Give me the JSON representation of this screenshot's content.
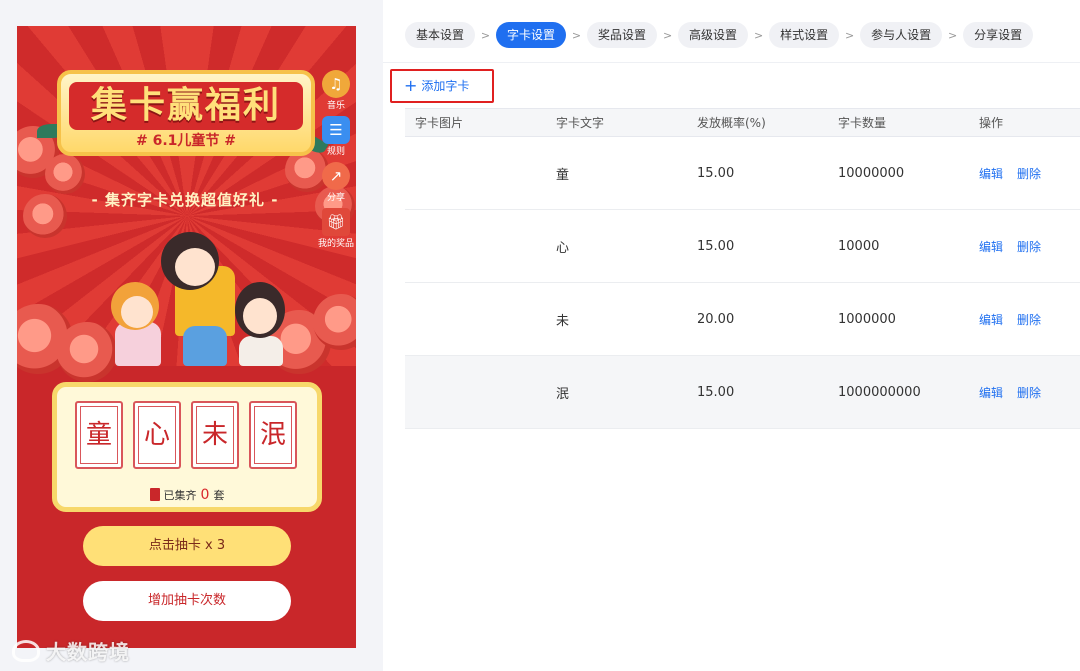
{
  "preview": {
    "title": "集卡赢福利",
    "festival": "# 6.1儿童节 #",
    "subtitle": "- 集齐字卡兑换超值好礼 -",
    "side_buttons": [
      {
        "label": "音乐",
        "icon": "music-icon",
        "color": "#f0a83a"
      },
      {
        "label": "规则",
        "icon": "rules-icon",
        "color": "#3a8ef0"
      },
      {
        "label": "分享",
        "icon": "share-icon",
        "color": "#f06a4a"
      },
      {
        "label": "我的奖品",
        "icon": "gift-icon",
        "color": "#e0483a"
      }
    ],
    "cards": [
      "童",
      "心",
      "未",
      "泯"
    ],
    "collected_prefix": "已集齐",
    "collected_count": "0",
    "collected_suffix": "套",
    "draw_button": "点击抽卡 x 3",
    "add_draws_button": "增加抽卡次数",
    "watermark": "大数跨境"
  },
  "steps": [
    {
      "label": "基本设置",
      "active": false
    },
    {
      "label": "字卡设置",
      "active": true
    },
    {
      "label": "奖品设置",
      "active": false
    },
    {
      "label": "高级设置",
      "active": false
    },
    {
      "label": "样式设置",
      "active": false
    },
    {
      "label": "参与人设置",
      "active": false
    },
    {
      "label": "分享设置",
      "active": false
    }
  ],
  "step_separator": ">",
  "add_card_label": "添加字卡",
  "table": {
    "headers": [
      "字卡图片",
      "字卡文字",
      "发放概率(%)",
      "字卡数量",
      "操作"
    ],
    "rows": [
      {
        "image": "",
        "text": "童",
        "probability": "15.00",
        "quantity": "10000000",
        "edit": "编辑",
        "delete": "删除"
      },
      {
        "image": "",
        "text": "心",
        "probability": "15.00",
        "quantity": "10000",
        "edit": "编辑",
        "delete": "删除"
      },
      {
        "image": "",
        "text": "未",
        "probability": "20.00",
        "quantity": "1000000",
        "edit": "编辑",
        "delete": "删除"
      },
      {
        "image": "",
        "text": "泯",
        "probability": "15.00",
        "quantity": "1000000000",
        "edit": "编辑",
        "delete": "删除"
      }
    ]
  },
  "colors": {
    "primary": "#1f6ff0",
    "festive_red": "#c9272a",
    "gold": "#ffe077",
    "highlight_border": "#e02020"
  }
}
